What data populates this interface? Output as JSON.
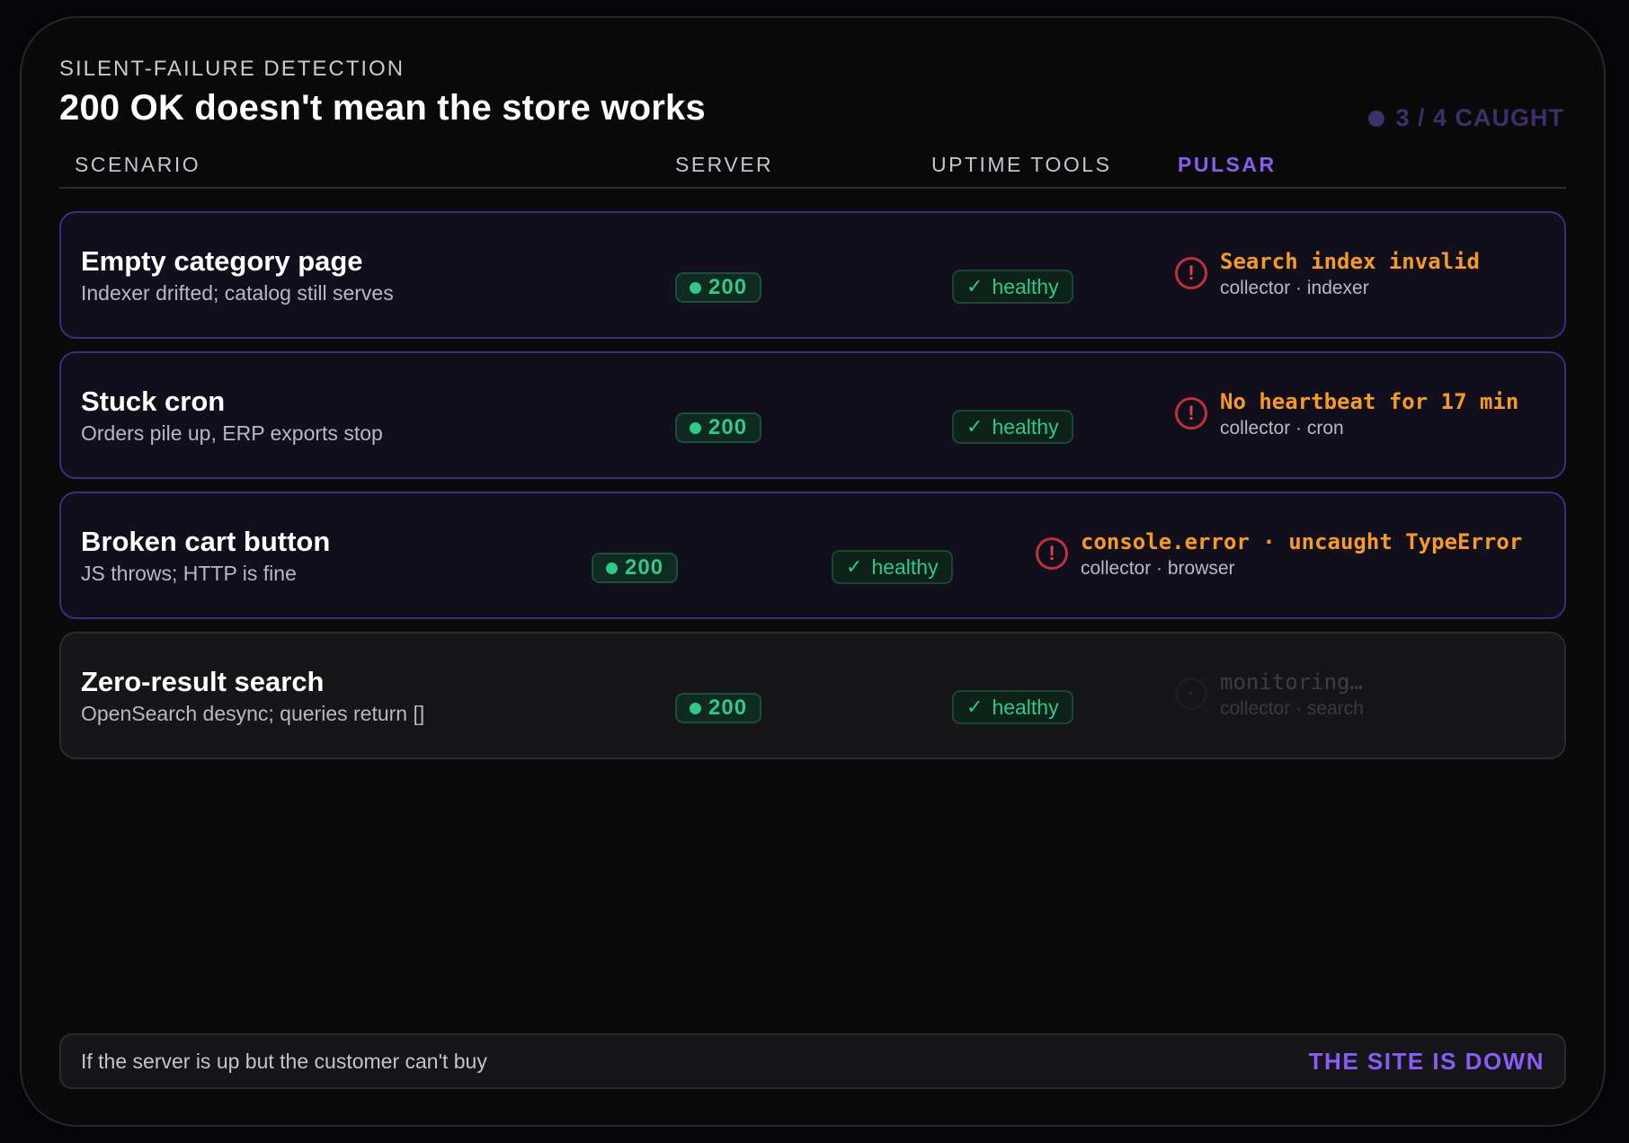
{
  "header": {
    "eyebrow": "SILENT-FAILURE DETECTION",
    "title": "200 OK doesn't mean the store works",
    "caught": "3 / 4 CAUGHT"
  },
  "columns": {
    "scenario": "SCENARIO",
    "server": "SERVER",
    "uptime": "UPTIME TOOLS",
    "pulsar": "PULSAR"
  },
  "rows": [
    {
      "title": "Empty category page",
      "subtitle": "Indexer drifted; catalog still serves",
      "server": "200",
      "uptime": "healthy",
      "alert_icon": "!",
      "pulsar_title": "Search index invalid",
      "pulsar_sub": "collector · indexer"
    },
    {
      "title": "Stuck cron",
      "subtitle": "Orders pile up, ERP exports stop",
      "server": "200",
      "uptime": "healthy",
      "alert_icon": "!",
      "pulsar_title": "No heartbeat for 17 min",
      "pulsar_sub": "collector · cron"
    },
    {
      "title": "Broken cart button",
      "subtitle": "JS throws; HTTP is fine",
      "server": "200",
      "uptime": "healthy",
      "alert_icon": "!",
      "pulsar_title": "console.error · uncaught TypeError",
      "pulsar_sub": "collector · browser"
    },
    {
      "title": "Zero-result search",
      "subtitle": "OpenSearch desync; queries return []",
      "server": "200",
      "uptime": "healthy",
      "alert_icon": "·",
      "pulsar_title": "monitoring…",
      "pulsar_sub": "collector · search"
    }
  ],
  "footer": {
    "text": "If the server is up but the customer can't buy",
    "cta": "THE SITE IS DOWN"
  },
  "colors": {
    "accent": "#8a5cf6",
    "ok_green": "#2ec98a",
    "alert_orange": "#f59a23",
    "alert_red": "#c0303a"
  }
}
